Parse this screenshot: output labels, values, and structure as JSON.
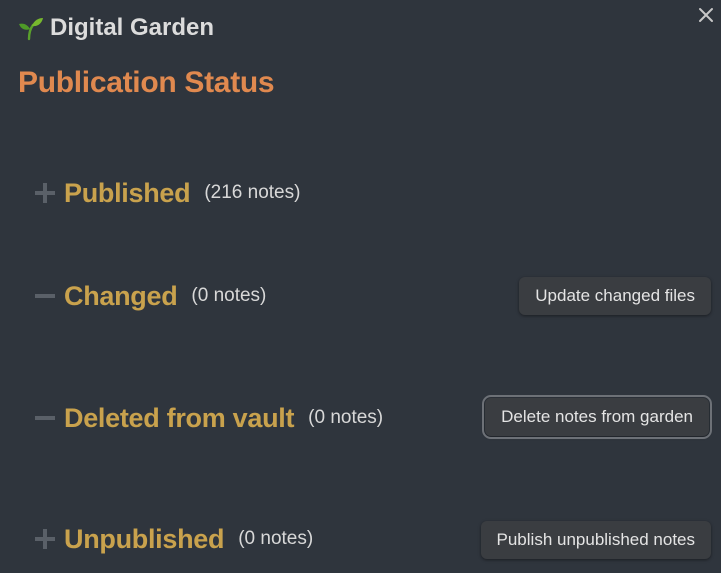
{
  "header": {
    "app_title": "Digital Garden",
    "app_icon": "sprout-icon",
    "close_icon": "close-icon"
  },
  "page_title": "Publication Status",
  "sections": [
    {
      "title": "Published",
      "count": "(216 notes)",
      "expanded": false,
      "action_label": null
    },
    {
      "title": "Changed",
      "count": "(0 notes)",
      "expanded": true,
      "action_label": "Update changed files"
    },
    {
      "title": "Deleted from vault",
      "count": "(0 notes)",
      "expanded": true,
      "action_label": "Delete notes from garden"
    },
    {
      "title": "Unpublished",
      "count": "(0 notes)",
      "expanded": false,
      "action_label": "Publish unpublished notes"
    }
  ],
  "colors": {
    "background": "#2f353d",
    "page_title": "#e0894f",
    "section_title": "#c9a24d",
    "button_bg": "#3a3d41"
  }
}
